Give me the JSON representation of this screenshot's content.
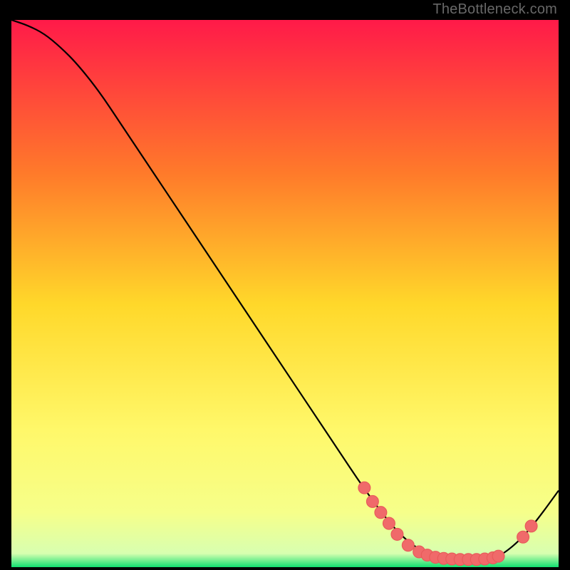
{
  "attribution": "TheBottleneck.com",
  "colors": {
    "bg_black": "#000000",
    "gradient_top": "#ff1a49",
    "gradient_mid1": "#ff7a2a",
    "gradient_mid2": "#ffd82a",
    "gradient_mid3": "#fff86a",
    "gradient_bottom_yellow": "#f6ff8a",
    "gradient_green": "#10e070",
    "curve": "#000000",
    "dot_fill": "#f06a6a",
    "dot_stroke": "#e85a5a"
  },
  "chart_data": {
    "type": "line",
    "title": "",
    "xlabel": "",
    "ylabel": "",
    "xlim": [
      0,
      100
    ],
    "ylim": [
      0,
      100
    ],
    "curve": {
      "comment": "Estimated points of the black curve, normalized 0..100 on each axis (origin at bottom-left of the colored square). Starts at top-left, bends, descends roughly linearly, flattens into a valley around x≈70-88, then rises to the right edge.",
      "x": [
        0,
        3,
        6,
        9,
        12,
        16,
        20,
        25,
        30,
        35,
        40,
        45,
        50,
        55,
        60,
        64,
        68,
        71,
        74,
        77,
        80,
        83,
        86,
        88,
        90,
        93,
        96,
        100
      ],
      "y": [
        100,
        99,
        97.5,
        95,
        92,
        87,
        81,
        73.5,
        66,
        58.5,
        51,
        43.5,
        36,
        28.5,
        21,
        15,
        9.5,
        6,
        3.5,
        2.2,
        1.6,
        1.4,
        1.4,
        1.6,
        2.5,
        5,
        8.5,
        14
      ]
    },
    "dots": {
      "comment": "Salmon dots along the valley and right-ascent of the curve.",
      "points": [
        {
          "x": 64.5,
          "y": 14.5
        },
        {
          "x": 66.0,
          "y": 12.0
        },
        {
          "x": 67.5,
          "y": 10.0
        },
        {
          "x": 69.0,
          "y": 8.0
        },
        {
          "x": 70.5,
          "y": 6.0
        },
        {
          "x": 72.5,
          "y": 4.0
        },
        {
          "x": 74.5,
          "y": 2.8
        },
        {
          "x": 76.0,
          "y": 2.2
        },
        {
          "x": 77.5,
          "y": 1.8
        },
        {
          "x": 79.0,
          "y": 1.6
        },
        {
          "x": 80.5,
          "y": 1.5
        },
        {
          "x": 82.0,
          "y": 1.4
        },
        {
          "x": 83.5,
          "y": 1.4
        },
        {
          "x": 85.0,
          "y": 1.4
        },
        {
          "x": 86.5,
          "y": 1.5
        },
        {
          "x": 88.0,
          "y": 1.7
        },
        {
          "x": 89.0,
          "y": 2.0
        },
        {
          "x": 93.5,
          "y": 5.5
        },
        {
          "x": 95.0,
          "y": 7.5
        }
      ],
      "radius_norm": 1.1
    }
  }
}
